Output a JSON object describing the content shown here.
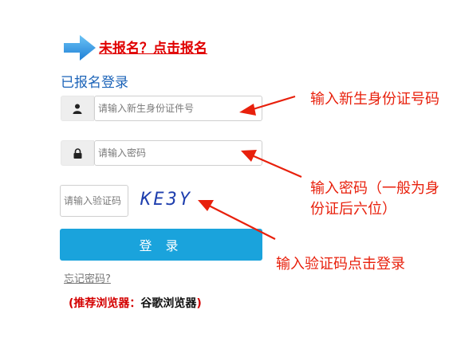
{
  "register": {
    "link_text": "未报名？点击报名"
  },
  "login": {
    "heading": "已报名登录",
    "id_placeholder": "请输入新生身份证件号",
    "password_placeholder": "请输入密码",
    "captcha_placeholder": "请输入验证码",
    "captcha_text": "KE3Y",
    "button_label": "登 录",
    "forgot_link": "忘记密码?",
    "browser_note_prefix": "(推荐浏览器：",
    "browser_note_value": "谷歌浏览器",
    "browser_note_suffix": ")"
  },
  "annotations": {
    "note_id": "输入新生身份证号码",
    "note_password": "输入密码（一般为身份证后六位）",
    "note_captcha": "输入验证码点击登录"
  },
  "icons": {
    "register_arrow": "arrow-right-icon",
    "user": "user-icon",
    "lock": "lock-icon"
  },
  "colors": {
    "link_red": "#e00000",
    "heading_blue": "#1b63b8",
    "button_blue": "#1aa3dc",
    "annotation_red": "#e8200c"
  }
}
